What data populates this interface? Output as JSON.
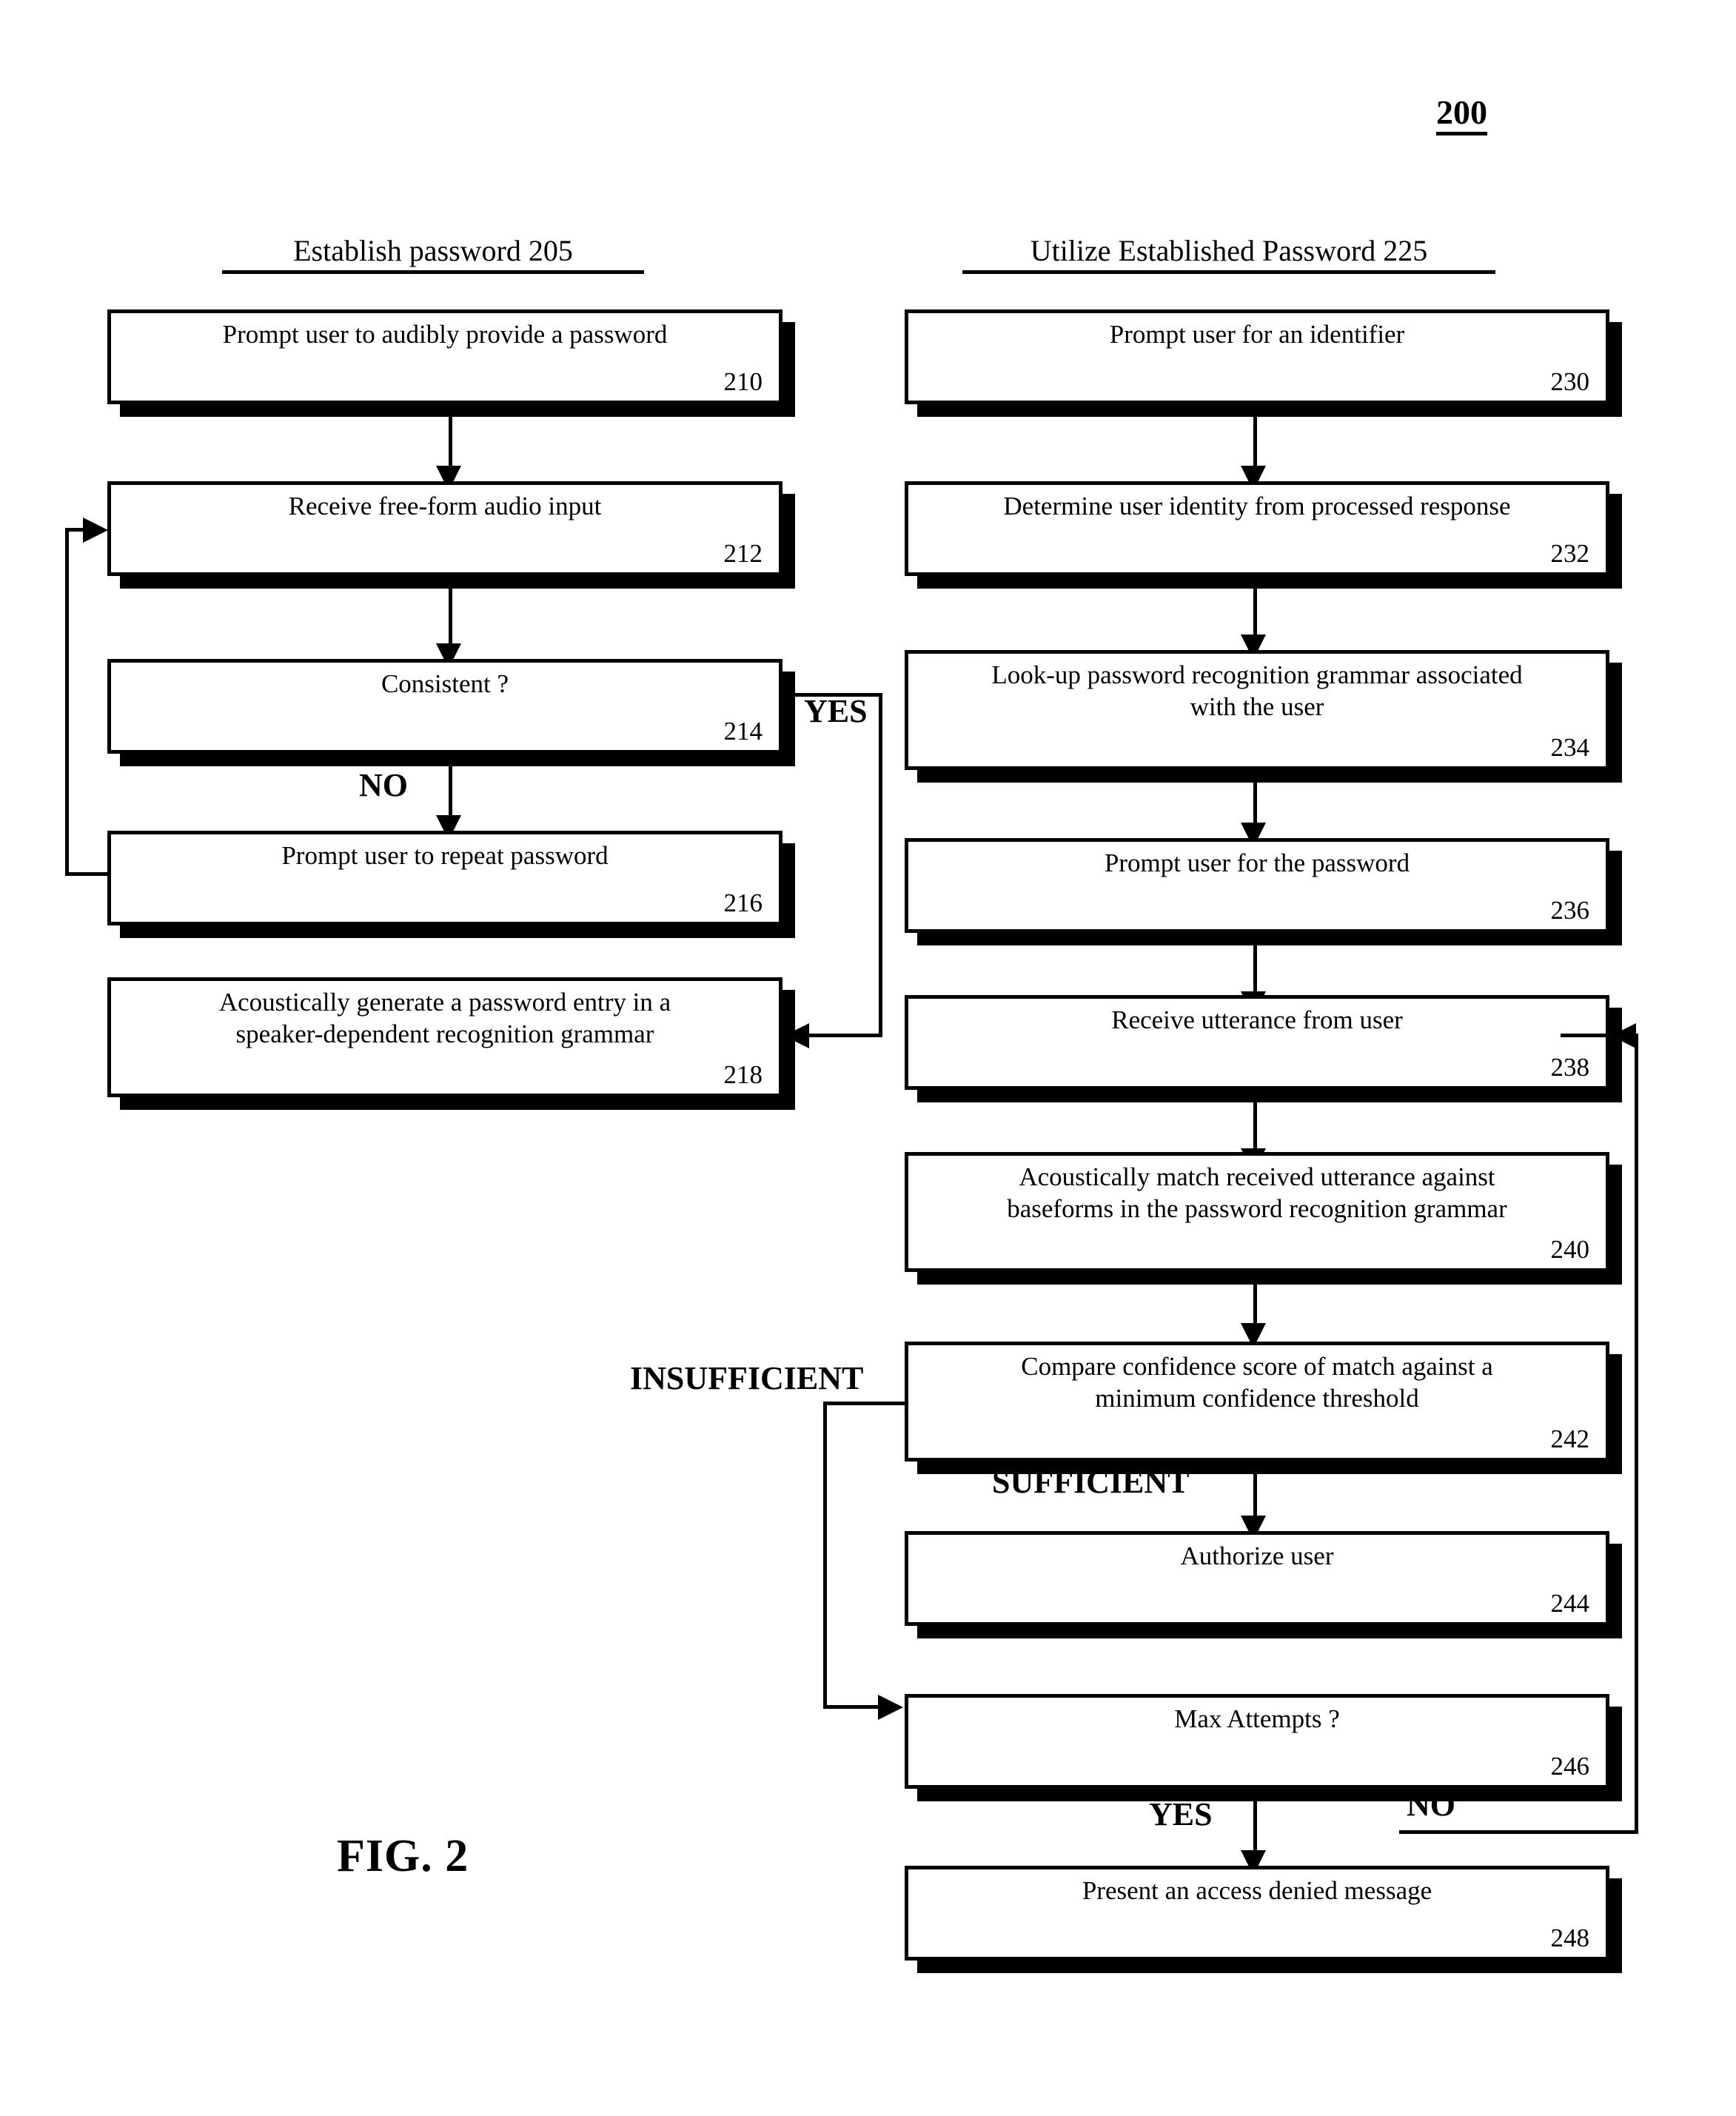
{
  "figure": {
    "number": "200",
    "caption": "FIG. 2"
  },
  "columns": [
    {
      "id": "establish",
      "heading": "Establish password 205"
    },
    {
      "id": "utilize",
      "heading": "Utilize Established Password 225"
    }
  ],
  "left_column": {
    "steps": [
      {
        "id": "210",
        "text": "Prompt user to audibly provide a password",
        "number": "210"
      },
      {
        "id": "212",
        "text": "Receive free-form audio input",
        "number": "212"
      },
      {
        "id": "214",
        "text": "Consistent ?",
        "number": "214"
      },
      {
        "id": "216",
        "text": "Prompt user to repeat password",
        "number": "216"
      },
      {
        "id": "218",
        "line1": "Acoustically generate a password entry in a",
        "line2": "speaker-dependent recognition grammar",
        "number": "218"
      }
    ],
    "edge_labels": {
      "yes": "YES",
      "no": "NO"
    }
  },
  "right_column": {
    "steps": [
      {
        "id": "230",
        "text": "Prompt user for an identifier",
        "number": "230"
      },
      {
        "id": "232",
        "text": "Determine user identity from processed response",
        "number": "232"
      },
      {
        "id": "234",
        "line1": "Look-up password recognition grammar associated",
        "line2": "with the user",
        "number": "234"
      },
      {
        "id": "236",
        "text": "Prompt user for the password",
        "number": "236"
      },
      {
        "id": "238",
        "text": "Receive utterance from user",
        "number": "238"
      },
      {
        "id": "240",
        "line1": "Acoustically match received utterance against",
        "line2": "baseforms in the password recognition grammar",
        "number": "240"
      },
      {
        "id": "242",
        "line1": "Compare confidence score of match against a",
        "line2": "minimum confidence threshold",
        "number": "242"
      },
      {
        "id": "244",
        "text": "Authorize user",
        "number": "244"
      },
      {
        "id": "246",
        "text": "Max Attempts ?",
        "number": "246"
      },
      {
        "id": "248",
        "text": "Present an access denied message",
        "number": "248"
      }
    ],
    "edge_labels": {
      "insufficient": "INSUFFICIENT",
      "sufficient": "SUFFICIENT",
      "yes": "YES",
      "no": "NO"
    }
  },
  "colors": {
    "ink": "#000000",
    "paper": "#ffffff"
  }
}
